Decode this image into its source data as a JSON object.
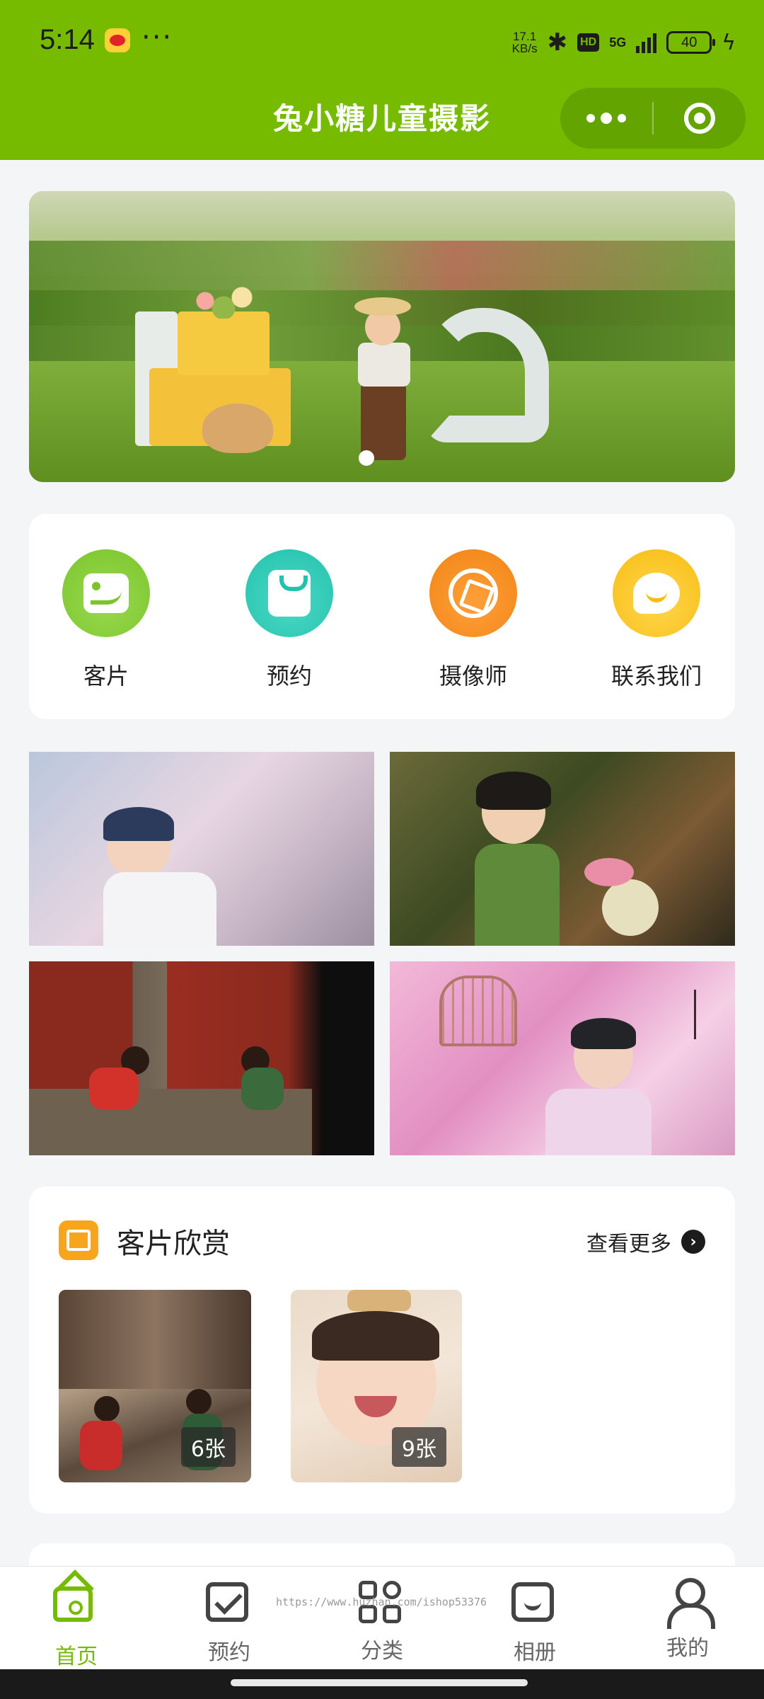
{
  "status_bar": {
    "time": "5:14",
    "net_speed_value": "17.1",
    "net_speed_unit": "KB/s",
    "hd": "HD",
    "network": "5G",
    "battery": "40"
  },
  "header": {
    "title": "兔小糖儿童摄影",
    "accent_color": "#76bb00"
  },
  "quick_nav": [
    {
      "label": "客片",
      "icon": "photo-icon"
    },
    {
      "label": "预约",
      "icon": "shopping-bag-icon"
    },
    {
      "label": "摄像师",
      "icon": "aperture-icon"
    },
    {
      "label": "联系我们",
      "icon": "chat-bubble-icon"
    }
  ],
  "section": {
    "title": "客片欣赏",
    "more_label": "查看更多",
    "albums": [
      {
        "count": "6张"
      },
      {
        "count": "9张"
      }
    ]
  },
  "watermark": "https://www.huzhan.com/ishop53376",
  "tabbar": {
    "items": [
      {
        "label": "首页",
        "icon": "home-icon",
        "active": true
      },
      {
        "label": "预约",
        "icon": "calendar-check-icon",
        "active": false
      },
      {
        "label": "分类",
        "icon": "category-grid-icon",
        "active": false
      },
      {
        "label": "相册",
        "icon": "album-icon",
        "active": false
      },
      {
        "label": "我的",
        "icon": "user-icon",
        "active": false
      }
    ]
  }
}
